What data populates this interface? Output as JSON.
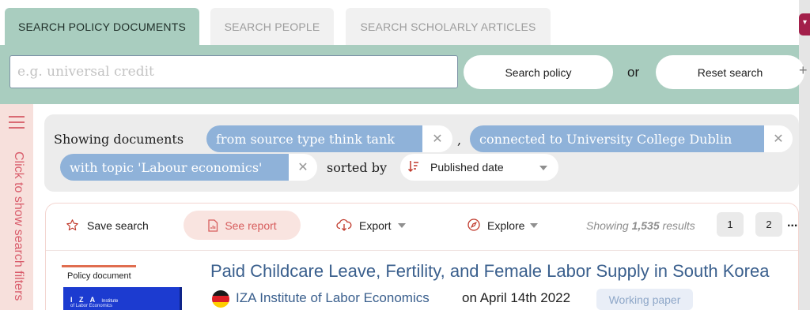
{
  "tabs": [
    {
      "label": "SEARCH POLICY DOCUMENTS"
    },
    {
      "label": "SEARCH PEOPLE"
    },
    {
      "label": "SEARCH SCHOLARLY ARTICLES"
    }
  ],
  "search": {
    "placeholder": "e.g. universal credit",
    "value": "",
    "search_label": "Search policy",
    "or_label": "or",
    "reset_label": "Reset search",
    "plus_icon": "+"
  },
  "sidebar": {
    "menu_icon": "hamburger-icon",
    "label": "Click to show search filters"
  },
  "filters": {
    "showing_label": "Showing documents",
    "separator": ",",
    "chips": [
      {
        "label": "from source type think tank"
      },
      {
        "label": "connected to University College Dublin"
      },
      {
        "label": "with topic 'Labour economics'"
      }
    ],
    "remove_glyph": "✕",
    "sorted_by_label": "sorted by",
    "sort_value": "Published date"
  },
  "toolbar": {
    "save_search": "Save search",
    "see_report": "See report",
    "export": "Export",
    "explore": "Explore",
    "showing_prefix": "Showing ",
    "results_count": "1,535",
    "showing_suffix": " results",
    "pages": [
      "1",
      "2"
    ],
    "more": "..."
  },
  "results": [
    {
      "doc_type": "Policy document",
      "title": "Paid Childcare Leave, Fertility, and Female Labor Supply in South Korea",
      "publisher": "IZA Institute of Labor Economics",
      "date": "on April 14th 2022",
      "badge": "Working paper",
      "thumb_title": "I Z A",
      "thumb_sub1": "Institute",
      "thumb_sub2": "of Labor Economics"
    }
  ],
  "colors": {
    "tab_active": "#a9cdbf",
    "chip": "#8fb2d9",
    "link": "#3a5f8d",
    "accent": "#d75d5d"
  }
}
